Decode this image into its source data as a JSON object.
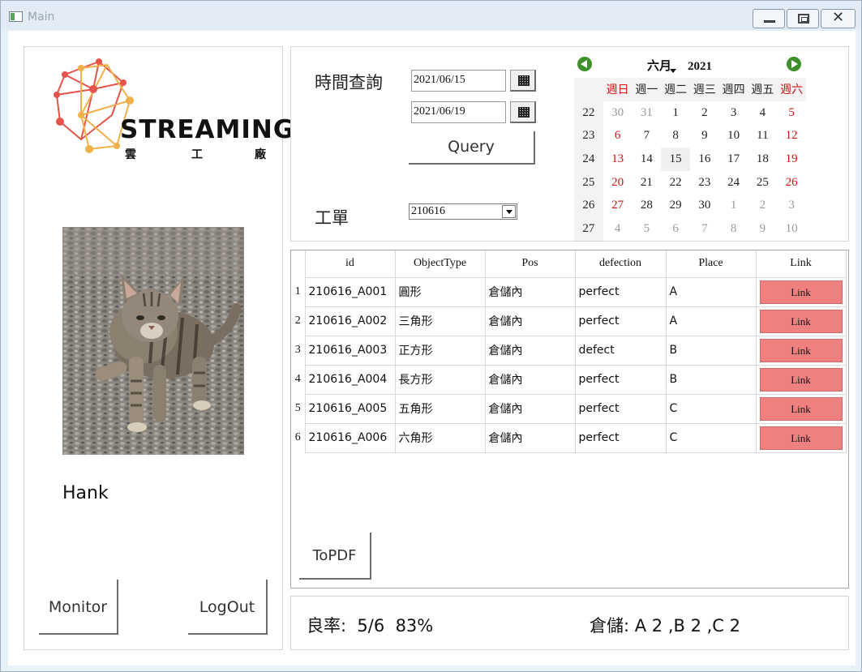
{
  "window": {
    "title": "Main"
  },
  "logo": {
    "text": "STREAMING",
    "sub": [
      "雲",
      "工",
      "廠"
    ]
  },
  "user": {
    "name": "Hank"
  },
  "buttons": {
    "monitor": "Monitor",
    "logout": "LogOut",
    "query": "Query",
    "topdf": "ToPDF"
  },
  "query": {
    "time_label": "時間查詢",
    "start_date": "2021/06/15",
    "end_date": "2021/06/19",
    "work_order_label": "工單",
    "work_order_value": "210616"
  },
  "calendar": {
    "month": "六月",
    "year": "2021",
    "weekdays": [
      "週日",
      "週一",
      "週二",
      "週三",
      "週四",
      "週五",
      "週六"
    ],
    "weeks": [
      {
        "wk": "22",
        "days": [
          "30",
          "31",
          "1",
          "2",
          "3",
          "4",
          "5"
        ]
      },
      {
        "wk": "23",
        "days": [
          "6",
          "7",
          "8",
          "9",
          "10",
          "11",
          "12"
        ]
      },
      {
        "wk": "24",
        "days": [
          "13",
          "14",
          "15",
          "16",
          "17",
          "18",
          "19"
        ]
      },
      {
        "wk": "25",
        "days": [
          "20",
          "21",
          "22",
          "23",
          "24",
          "25",
          "26"
        ]
      },
      {
        "wk": "26",
        "days": [
          "27",
          "28",
          "29",
          "30",
          "1",
          "2",
          "3"
        ]
      },
      {
        "wk": "27",
        "days": [
          "4",
          "5",
          "6",
          "7",
          "8",
          "9",
          "10"
        ]
      }
    ],
    "selected_day": "15"
  },
  "grid": {
    "columns": [
      "id",
      "ObjectType",
      "Pos",
      "defection",
      "Place",
      "Link"
    ],
    "rows": [
      {
        "n": "1",
        "id": "210616_A001",
        "type": "圓形",
        "pos": "倉儲內",
        "defection": "perfect",
        "place": "A",
        "link": "Link"
      },
      {
        "n": "2",
        "id": "210616_A002",
        "type": "三角形",
        "pos": "倉儲內",
        "defection": "perfect",
        "place": "A",
        "link": "Link"
      },
      {
        "n": "3",
        "id": "210616_A003",
        "type": "正方形",
        "pos": "倉儲內",
        "defection": "defect",
        "place": "B",
        "link": "Link"
      },
      {
        "n": "4",
        "id": "210616_A004",
        "type": "長方形",
        "pos": "倉儲內",
        "defection": "perfect",
        "place": "B",
        "link": "Link"
      },
      {
        "n": "5",
        "id": "210616_A005",
        "type": "五角形",
        "pos": "倉儲內",
        "defection": "perfect",
        "place": "C",
        "link": "Link"
      },
      {
        "n": "6",
        "id": "210616_A006",
        "type": "六角形",
        "pos": "倉儲內",
        "defection": "perfect",
        "place": "C",
        "link": "Link"
      }
    ]
  },
  "status": {
    "yield_text": "良率:  5/6  83%",
    "storage_text": "倉儲: A 2 ,B 2 ,C 2"
  },
  "colors": {
    "link_button": "#ee8080",
    "weekend_red": "#d01010",
    "nav_green": "#3f8f2a"
  }
}
